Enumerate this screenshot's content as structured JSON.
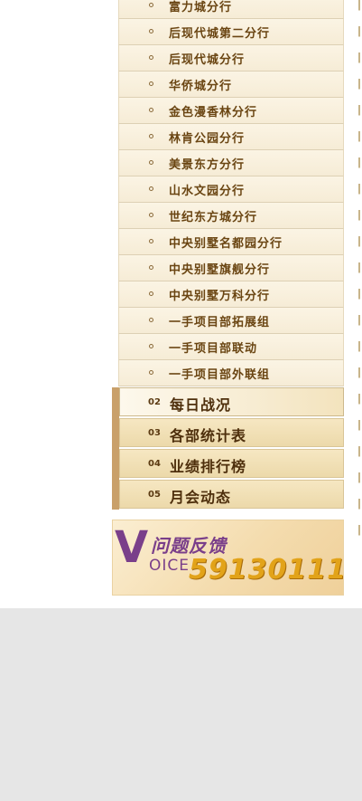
{
  "submenu": {
    "items": [
      {
        "label": "富力城分行"
      },
      {
        "label": "后现代城第二分行"
      },
      {
        "label": "后现代城分行"
      },
      {
        "label": "华侨城分行"
      },
      {
        "label": "金色漫香林分行"
      },
      {
        "label": "林肯公园分行"
      },
      {
        "label": "美景东方分行"
      },
      {
        "label": "山水文园分行"
      },
      {
        "label": "世纪东方城分行"
      },
      {
        "label": "中央别墅名都园分行"
      },
      {
        "label": "中央别墅旗舰分行"
      },
      {
        "label": "中央别墅万科分行"
      },
      {
        "label": "一手项目部拓展组"
      },
      {
        "label": "一手项目部联动"
      },
      {
        "label": "一手项目部外联组"
      }
    ]
  },
  "menu": {
    "items": [
      {
        "num": "02",
        "title": "每日战况",
        "active": true
      },
      {
        "num": "03",
        "title": "各部统计表",
        "active": false
      },
      {
        "num": "04",
        "title": "业绩排行榜",
        "active": false
      },
      {
        "num": "05",
        "title": "月会动态",
        "active": false
      }
    ]
  },
  "feedback": {
    "v_letter": "V",
    "oice": "OICE",
    "title": "问题反馈",
    "phone": "59130111"
  },
  "colors": {
    "accent_text": "#6a4512",
    "banner_purple": "#7a3f8a",
    "banner_gold": "#e2a319"
  }
}
